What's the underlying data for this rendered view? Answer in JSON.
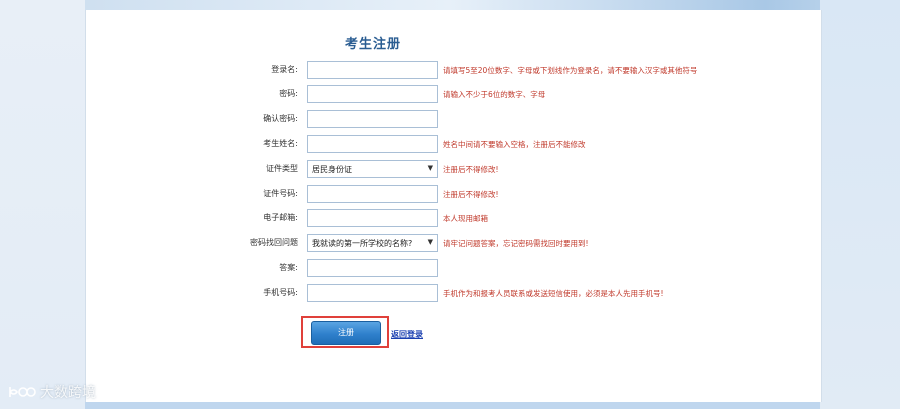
{
  "form": {
    "title": "考生注册",
    "fields": [
      {
        "label": "登录名:",
        "type": "input",
        "value": "",
        "hint": "请填写5至20位数字、字母或下划线作为登录名，请不要输入汉字或其他符号"
      },
      {
        "label": "密码:",
        "type": "input",
        "value": "",
        "hint": "请输入不少于6位的数字、字母"
      },
      {
        "label": "确认密码:",
        "type": "input",
        "value": "",
        "hint": ""
      },
      {
        "label": "考生姓名:",
        "type": "input",
        "value": "",
        "hint": "姓名中间请不要输入空格，注册后不能修改"
      },
      {
        "label": "证件类型",
        "type": "select",
        "value": "居民身份证",
        "hint": "注册后不得修改!"
      },
      {
        "label": "证件号码:",
        "type": "input",
        "value": "",
        "hint": "注册后不得修改!"
      },
      {
        "label": "电子邮箱:",
        "type": "input",
        "value": "",
        "hint": "本人现用邮箱"
      },
      {
        "label": "密码找回问题",
        "type": "select",
        "value": "我就读的第一所学校的名称?",
        "hint": "请牢记问题答案，忘记密码需找回时要用到!"
      },
      {
        "label": "答案:",
        "type": "input",
        "value": "",
        "hint": ""
      },
      {
        "label": "手机号码:",
        "type": "input",
        "value": "",
        "hint": "手机作为和报考人员联系或发送短信使用，必须是本人先用手机号!"
      }
    ],
    "register_label": "注册",
    "back_label": "返回登录"
  },
  "watermark": {
    "text": "大数跨境"
  }
}
